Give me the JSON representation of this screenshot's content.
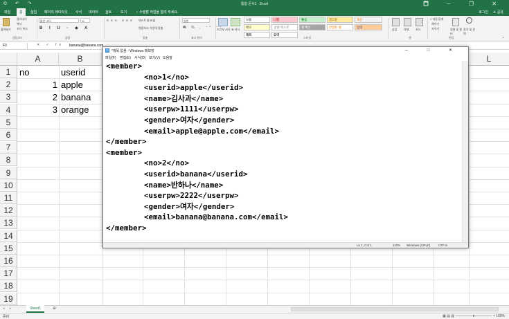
{
  "excel": {
    "window_title": "통합 문서1 - Excel",
    "quick_access": "⟲ ↶ ↷",
    "window_controls": "🗖 ─ ❐ ✕",
    "tabs": [
      "파일",
      "홈",
      "삽입",
      "페이지 레이아웃",
      "수식",
      "데이터",
      "검토",
      "보기"
    ],
    "tell_me": "♀ 수행할 작업을 알려 주세요.",
    "login": "로그인",
    "share": "♙ 공유",
    "ribbon": {
      "clipboard": {
        "paste": "붙여넣기",
        "cut": "잘라내기",
        "copy": "복사",
        "format_painter": "서식 복사",
        "group": "클립보드"
      },
      "font": {
        "name": "맑은 고딕",
        "size": "11",
        "group": "글꼴"
      },
      "alignment": {
        "wrap": "텍스트 줄 바꿈",
        "merge": "병합하고 가운데 맞춤",
        "group": "맞춤"
      },
      "number": {
        "format": "일반",
        "group": "표시 형식"
      },
      "styles": {
        "cond": "조건부 서식",
        "table": "표 서식",
        "boxes": [
          "보통",
          "나쁨",
          "좋음",
          "경고문",
          "계산",
          "메모",
          "설명 텍스트",
          "셀 확인",
          "연결된 셀",
          "입력",
          "제목",
          "요약"
        ],
        "group": "스타일"
      },
      "cells": {
        "insert": "삽입",
        "delete": "삭제",
        "format": "서식",
        "group": "셀"
      },
      "editing": {
        "autosum": "Σ 자동 합계",
        "fill": "채우기",
        "clear": "지우기",
        "sort": "정렬 및 필터",
        "find": "찾기 및 선택",
        "group": "편집"
      }
    },
    "name_box": "F3",
    "formula_icons": "✕ ✓ fx",
    "formula_value": "banana@banana.com",
    "columns": [
      "A",
      "B",
      "L"
    ],
    "rows": [
      "1",
      "2",
      "3",
      "4",
      "5",
      "6",
      "7",
      "8",
      "9",
      "10",
      "11",
      "12",
      "13",
      "14",
      "15",
      "16",
      "17",
      "18",
      "19"
    ],
    "cells": {
      "A1": "no",
      "B1": "userid",
      "A2": "1",
      "B2": "apple",
      "A3": "2",
      "B3": "banana",
      "A4": "3",
      "B4": "orange"
    },
    "sheet_tab": "Sheet1",
    "add_sheet": "⊕",
    "status_left": "준비",
    "status_right": "▦ ▤ ▥  —————●—————  +  100%"
  },
  "notepad": {
    "title": "*제목 없음 - Windows 메모장",
    "window_controls": "─ □ ✕",
    "menu": [
      "파일(F)",
      "편집(E)",
      "서식(O)",
      "보기(V)",
      "도움말"
    ],
    "lines": [
      "<member>",
      "<no>1</no>",
      "<userid>apple</userid>",
      "<name>김사과</name>",
      "<userpw>1111</userpw>",
      "<gender>여자</gender>",
      "<email>apple@apple.com</email>",
      "</member>",
      "<member>",
      "<no>2</no>",
      "<userid>banana</userid>",
      "<name>반하나</name>",
      "<userpw>2222</userpw>",
      "<gender>여자</gender>",
      "<email>banana@banana.com</email>",
      "</member>"
    ],
    "status": {
      "position": "Ln 1, Col 1",
      "zoom": "110%",
      "eol": "Windows (CRLF)",
      "encoding": "UTF-8"
    }
  }
}
